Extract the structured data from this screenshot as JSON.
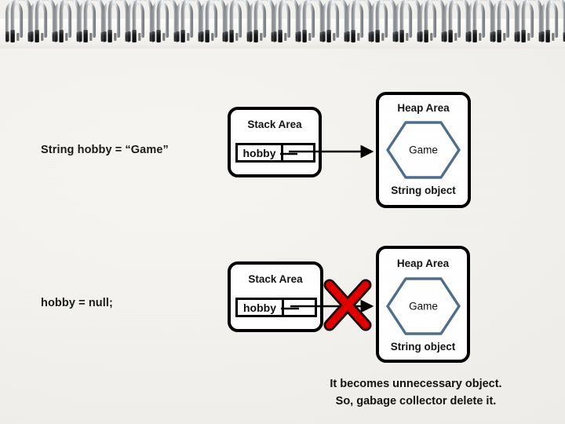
{
  "page": {
    "background_color": "#f2f1ee",
    "binding": {
      "icon": "spiral-binding",
      "coil_count": 23
    }
  },
  "diagram_one": {
    "code_text": "String hobby = “Game”",
    "stack": {
      "title": "Stack Area",
      "variable_name": "hobby",
      "variable_value": ""
    },
    "heap": {
      "title": "Heap Area",
      "object_value": "Game",
      "caption": "String object",
      "shape": "hexagon",
      "shape_color": "#4e6e8e"
    },
    "reference_arrow": {
      "icon": "arrow-right-icon",
      "broken": false
    }
  },
  "diagram_two": {
    "code_text": "hobby = null;",
    "stack": {
      "title": "Stack Area",
      "variable_name": "hobby",
      "variable_value": ""
    },
    "heap": {
      "title": "Heap Area",
      "object_value": "Game",
      "caption": "String object",
      "shape": "hexagon",
      "shape_color": "#4e6e8e"
    },
    "reference_arrow": {
      "icon": "arrow-right-icon",
      "broken": true
    },
    "break_marker": {
      "icon": "red-x-icon",
      "color": "#e00000"
    }
  },
  "footnote": {
    "line1": "It becomes unnecessary object.",
    "line2": "So, gabage collector delete it."
  }
}
